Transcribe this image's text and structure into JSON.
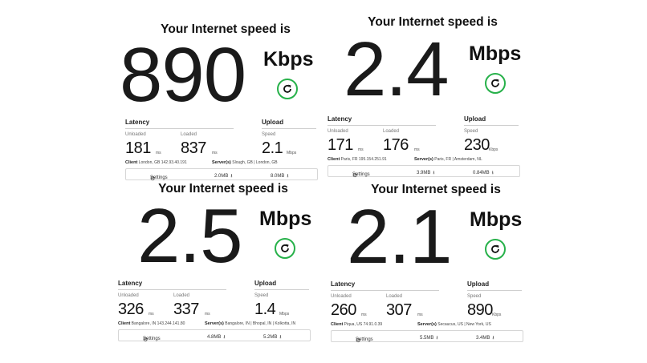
{
  "panels": [
    {
      "heading": "Your Internet speed is",
      "speed": "890",
      "unit": "Kbps",
      "latency_label": "Latency",
      "upload_label": "Upload",
      "unloaded_label": "Unloaded",
      "loaded_label": "Loaded",
      "speed_label": "Speed",
      "unloaded": "181",
      "unloaded_unit": "ms",
      "loaded": "837",
      "loaded_unit": "ms",
      "upload": "2.1",
      "upload_unit": "Mbps",
      "client_label": "Client",
      "client": "London, GB    142.93.40.191",
      "server_label": "Server(s)",
      "server": "Slough, GB  |  London, GB",
      "settings_label": "Settings",
      "download_data": "2.0MB",
      "upload_data": "8.0MB"
    },
    {
      "heading": "Your Internet speed is",
      "speed": "2.4",
      "unit": "Mbps",
      "latency_label": "Latency",
      "upload_label": "Upload",
      "unloaded_label": "Unloaded",
      "loaded_label": "Loaded",
      "speed_label": "Speed",
      "unloaded": "171",
      "unloaded_unit": "ms",
      "loaded": "176",
      "loaded_unit": "ms",
      "upload": "230",
      "upload_unit": "Kbps",
      "client_label": "Client",
      "client": "Paris, FR    195.154.251.91",
      "server_label": "Server(s)",
      "server": "Paris, FR  |  Amsterdam, NL",
      "settings_label": "Settings",
      "download_data": "3.9MB",
      "upload_data": "0.84MB"
    },
    {
      "heading": "Your Internet speed is",
      "speed": "2.5",
      "unit": "Mbps",
      "latency_label": "Latency",
      "upload_label": "Upload",
      "unloaded_label": "Unloaded",
      "loaded_label": "Loaded",
      "speed_label": "Speed",
      "unloaded": "326",
      "unloaded_unit": "ms",
      "loaded": "337",
      "loaded_unit": "ms",
      "upload": "1.4",
      "upload_unit": "Mbps",
      "client_label": "Client",
      "client": "Bangalore, IN    143.244.141.80",
      "server_label": "Server(s)",
      "server": "Bangalore, IN  |  Bhopal, IN  |  Kolkotta, IN",
      "settings_label": "Settings",
      "download_data": "4.8MB",
      "upload_data": "5.2MB"
    },
    {
      "heading": "Your Internet speed is",
      "speed": "2.1",
      "unit": "Mbps",
      "latency_label": "Latency",
      "upload_label": "Upload",
      "unloaded_label": "Unloaded",
      "loaded_label": "Loaded",
      "speed_label": "Speed",
      "unloaded": "260",
      "unloaded_unit": "ms",
      "loaded": "307",
      "loaded_unit": "ms",
      "upload": "890",
      "upload_unit": "Kbps",
      "client_label": "Client",
      "client": "Piqua, US    74.91.0.39",
      "server_label": "Server(s)",
      "server": "Secaucus, US  |  New York, US",
      "settings_label": "Settings",
      "download_data": "5.5MB",
      "upload_data": "3.4MB"
    }
  ],
  "icons": {
    "refresh": "refresh-icon",
    "settings": "gear-icon",
    "download": "download-arrow-icon",
    "upload": "upload-arrow-icon"
  },
  "colors": {
    "refresh_ring": "#27b14a",
    "text": "#111111",
    "divider": "#cfcfcf"
  }
}
